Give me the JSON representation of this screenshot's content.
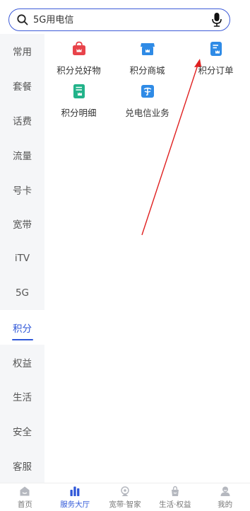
{
  "search": {
    "placeholder": "5G用电信"
  },
  "sidebar": {
    "items": [
      {
        "label": "常用"
      },
      {
        "label": "套餐"
      },
      {
        "label": "话费"
      },
      {
        "label": "流量"
      },
      {
        "label": "号卡"
      },
      {
        "label": "宽带"
      },
      {
        "label": "iTV"
      },
      {
        "label": "5G"
      },
      {
        "label": "积分"
      },
      {
        "label": "权益"
      },
      {
        "label": "生活"
      },
      {
        "label": "安全"
      },
      {
        "label": "客服"
      }
    ],
    "active_label": "积分"
  },
  "grid": {
    "items": [
      {
        "label": "积分兑好物",
        "icon": "gift-bag-icon",
        "color": "#e8434a"
      },
      {
        "label": "积分商城",
        "icon": "shop-icon",
        "color": "#2f8be6"
      },
      {
        "label": "积分订单",
        "icon": "order-icon",
        "color": "#2f8be6"
      },
      {
        "label": "积分明细",
        "icon": "detail-list-icon",
        "color": "#22b38a"
      },
      {
        "label": "兑电信业务",
        "icon": "telecom-icon",
        "color": "#2f8be6"
      }
    ]
  },
  "bottom_nav": {
    "items": [
      {
        "label": "首页",
        "icon": "home-icon"
      },
      {
        "label": "服务大厅",
        "icon": "service-hall-icon"
      },
      {
        "label": "宽带·智家",
        "icon": "broadband-icon"
      },
      {
        "label": "生活·权益",
        "icon": "life-icon"
      },
      {
        "label": "我的",
        "icon": "profile-icon"
      }
    ],
    "active_label": "服务大厅"
  },
  "colors": {
    "accent": "#2f57d8",
    "sidebar_bg": "#f5f6f8",
    "annotation_arrow": "#e02020"
  }
}
